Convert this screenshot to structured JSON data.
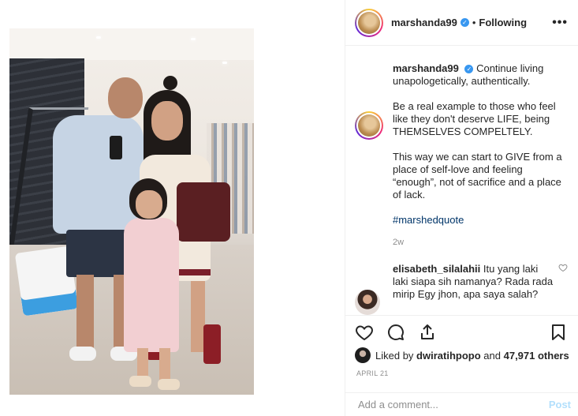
{
  "post": {
    "username": "marshanda99",
    "follow_status": "Following",
    "separator": "•",
    "more_label": "•••"
  },
  "caption": {
    "username": "marshanda99",
    "paragraph1": "Continue living unapologetically, authentically.",
    "paragraph2": "Be a real example to those who feel like they don't deserve LIFE, being THEMSELVES COMPELTELY.",
    "paragraph3": "This way we can start to GIVE from a place of self-love and feeling “enough”, not of sacrifice and a place of lack.",
    "hashtag": "#marshedquote",
    "age": "2w"
  },
  "comment": {
    "username": "elisabeth_silalahii",
    "text": "Itu yang laki laki siapa sih namanya? Rada rada mirip Egy jhon, apa saya salah?"
  },
  "likes": {
    "prefix": "Liked by",
    "user": "dwiratihpopo",
    "and": "and",
    "count": "47,971 others"
  },
  "date": "APRIL 21",
  "add_comment": {
    "placeholder": "Add a comment...",
    "post_label": "Post"
  },
  "icons": {
    "heart": "heart-icon",
    "comment": "comment-icon",
    "share": "share-icon",
    "save": "bookmark-icon",
    "verified": "verified-badge-icon"
  },
  "colors": {
    "verified": "#3897f0",
    "hashtag": "#003569",
    "post_disabled": "#b2dffc",
    "muted": "#8e8e8e"
  }
}
